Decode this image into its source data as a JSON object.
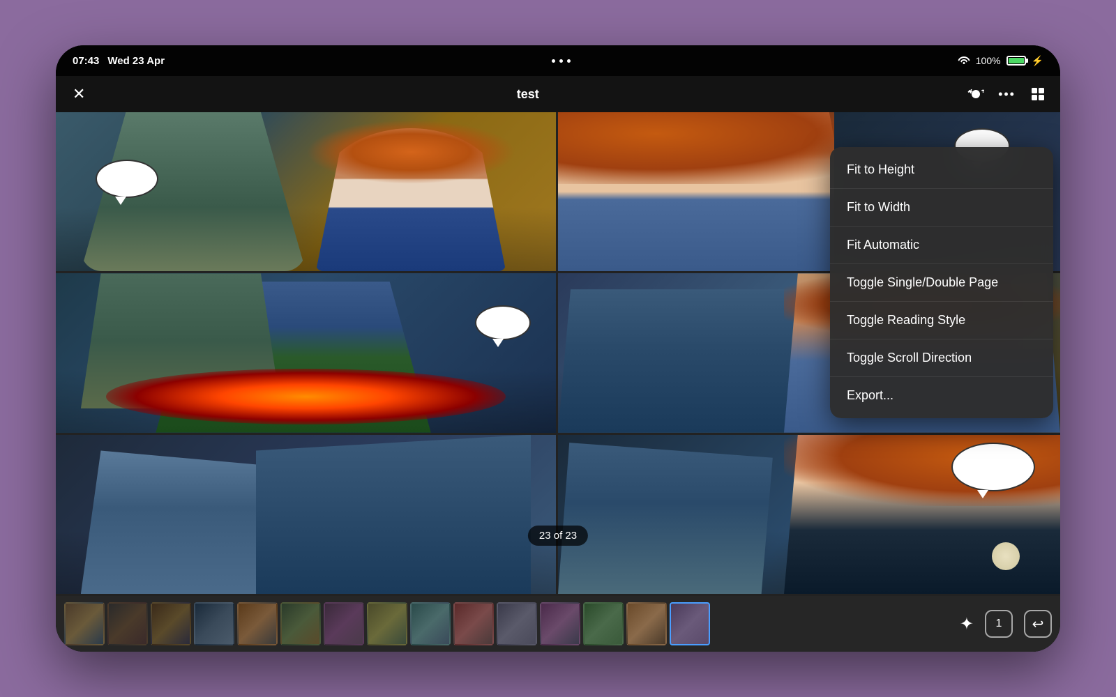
{
  "status_bar": {
    "time": "07:43",
    "date": "Wed 23 Apr",
    "battery_percent": "100%",
    "signal": "wifi"
  },
  "nav": {
    "title": "test",
    "close_label": "✕",
    "icons": {
      "settings": "⚙",
      "more": "···",
      "grid": "⊞"
    }
  },
  "page_indicator": {
    "current": 23,
    "total": 23,
    "label": "23 of 23"
  },
  "context_menu": {
    "items": [
      {
        "id": "fit-height",
        "label": "Fit to Height"
      },
      {
        "id": "fit-width",
        "label": "Fit to Width"
      },
      {
        "id": "fit-automatic",
        "label": "Fit Automatic"
      },
      {
        "id": "toggle-page",
        "label": "Toggle Single/Double Page"
      },
      {
        "id": "toggle-reading",
        "label": "Toggle Reading Style"
      },
      {
        "id": "toggle-scroll",
        "label": "Toggle Scroll Direction"
      },
      {
        "id": "export",
        "label": "Export..."
      }
    ]
  },
  "thumbnail_strip": {
    "items_count": 15,
    "active_index": 14,
    "actions": {
      "sparkle": "✦",
      "page_num": "1",
      "back": "↩"
    }
  }
}
